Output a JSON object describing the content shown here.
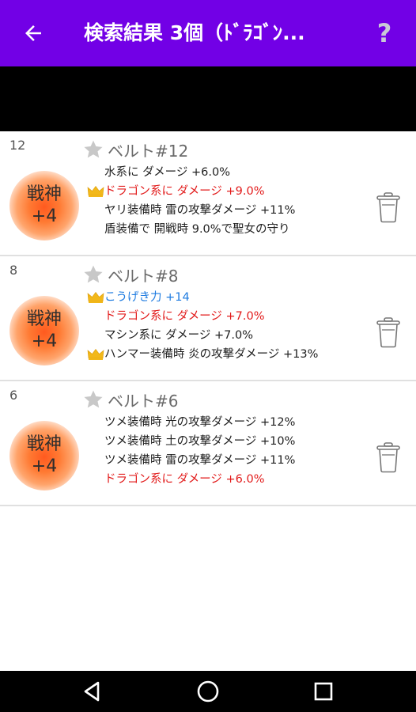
{
  "appbar": {
    "title": "検索結果 3個（ﾄﾞﾗｺﾞﾝ...",
    "help_label": "?"
  },
  "icons": [
    "back-arrow-icon",
    "star-icon",
    "crown-icon",
    "trash-icon",
    "nav-back-icon",
    "nav-home-icon",
    "nav-recents-icon"
  ],
  "colors": {
    "appbar": "#7200e6",
    "red_text": "#e21b1b",
    "blue_text": "#1e7be0",
    "crown": "#f2b81a"
  },
  "results": [
    {
      "number": "12",
      "badge_line1": "戦神",
      "badge_line2": "+4",
      "title": "ベルト#12",
      "effects": [
        {
          "text": "水系に ダメージ +6.0%",
          "style": "normal",
          "crown": false
        },
        {
          "text": "ドラゴン系に ダメージ +9.0%",
          "style": "red",
          "crown": true
        },
        {
          "text": "ヤリ装備時 雷の攻撃ダメージ +11%",
          "style": "normal",
          "crown": false
        },
        {
          "text": "盾装備で 開戦時 9.0%で聖女の守り",
          "style": "normal",
          "crown": false
        }
      ]
    },
    {
      "number": "8",
      "badge_line1": "戦神",
      "badge_line2": "+4",
      "title": "ベルト#8",
      "effects": [
        {
          "text": "こうげき力 +14",
          "style": "blue",
          "crown": true
        },
        {
          "text": "ドラゴン系に ダメージ +7.0%",
          "style": "red",
          "crown": false
        },
        {
          "text": "マシン系に ダメージ +7.0%",
          "style": "normal",
          "crown": false
        },
        {
          "text": "ハンマー装備時 炎の攻撃ダメージ +13%",
          "style": "normal",
          "crown": true
        }
      ]
    },
    {
      "number": "6",
      "badge_line1": "戦神",
      "badge_line2": "+4",
      "title": "ベルト#6",
      "effects": [
        {
          "text": "ツメ装備時 光の攻撃ダメージ +12%",
          "style": "normal",
          "crown": false
        },
        {
          "text": "ツメ装備時 土の攻撃ダメージ +10%",
          "style": "normal",
          "crown": false
        },
        {
          "text": "ツメ装備時 雷の攻撃ダメージ +11%",
          "style": "normal",
          "crown": false
        },
        {
          "text": "ドラゴン系に ダメージ +6.0%",
          "style": "red",
          "crown": false
        }
      ]
    }
  ]
}
